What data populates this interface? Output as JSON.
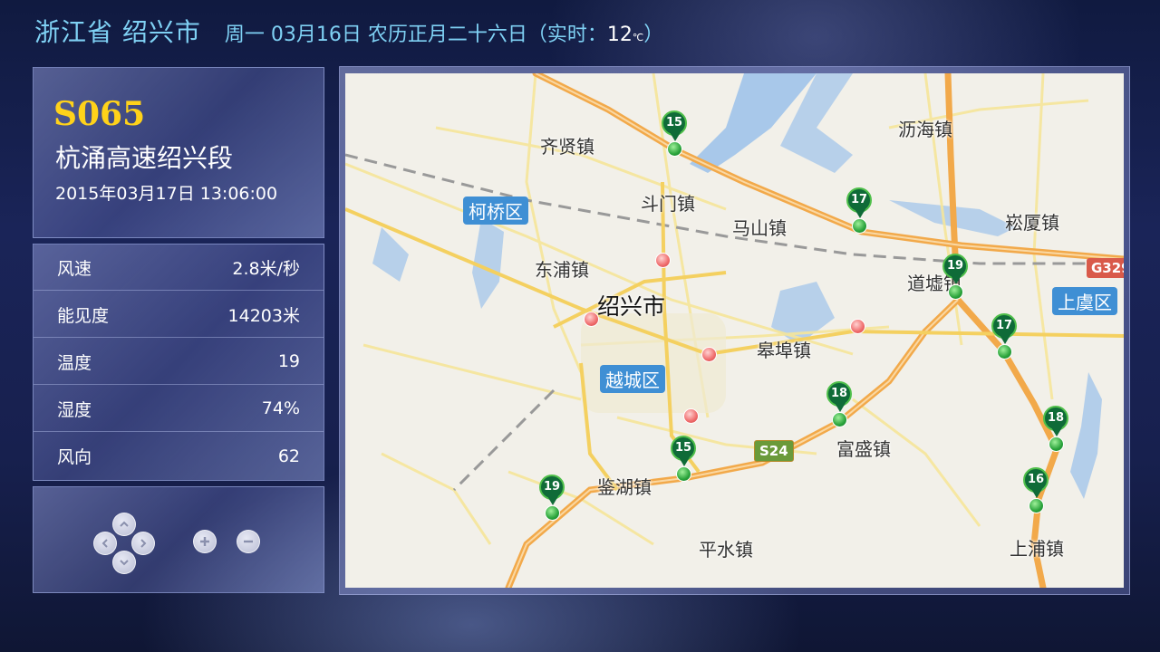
{
  "header": {
    "city": "浙江省 绍兴市",
    "date": "周一 03月16日 农历正月二十六日",
    "realtime_prefix": "（实时：",
    "temperature": "12",
    "temperature_unit": "℃",
    "realtime_suffix": "）"
  },
  "station": {
    "code": "S065",
    "road_name": "杭涌高速绍兴段",
    "timestamp": "2015年03月17日  13:06:00"
  },
  "stats": [
    {
      "label": "风速",
      "value": "2.8米/秒"
    },
    {
      "label": "能见度",
      "value": "14203米"
    },
    {
      "label": "温度",
      "value": "19"
    },
    {
      "label": "湿度",
      "value": "74%"
    },
    {
      "label": "风向",
      "value": "62"
    }
  ],
  "controls": {
    "icons": [
      "arrow-up-icon",
      "arrow-left-icon",
      "arrow-right-icon",
      "arrow-down-icon",
      "zoom-in-icon",
      "zoom-out-icon"
    ]
  },
  "map": {
    "places": [
      "齐贤镇",
      "沥海镇",
      "斗门镇",
      "马山镇",
      "崧厦镇",
      "东浦镇",
      "道墟镇",
      "皋埠镇",
      "富盛镇",
      "鉴湖镇",
      "平水镇",
      "上浦镇"
    ],
    "city_label": "绍兴市",
    "districts": [
      "柯桥区",
      "越城区",
      "上虞区"
    ],
    "highways": [
      "S24",
      "G329"
    ],
    "markers": [
      "15",
      "17",
      "19",
      "17",
      "18",
      "18",
      "15",
      "19",
      "16"
    ],
    "colors": {
      "marker": "#0f6b38",
      "district": "#3f8fd4",
      "expressway": "#f2a94a"
    }
  }
}
